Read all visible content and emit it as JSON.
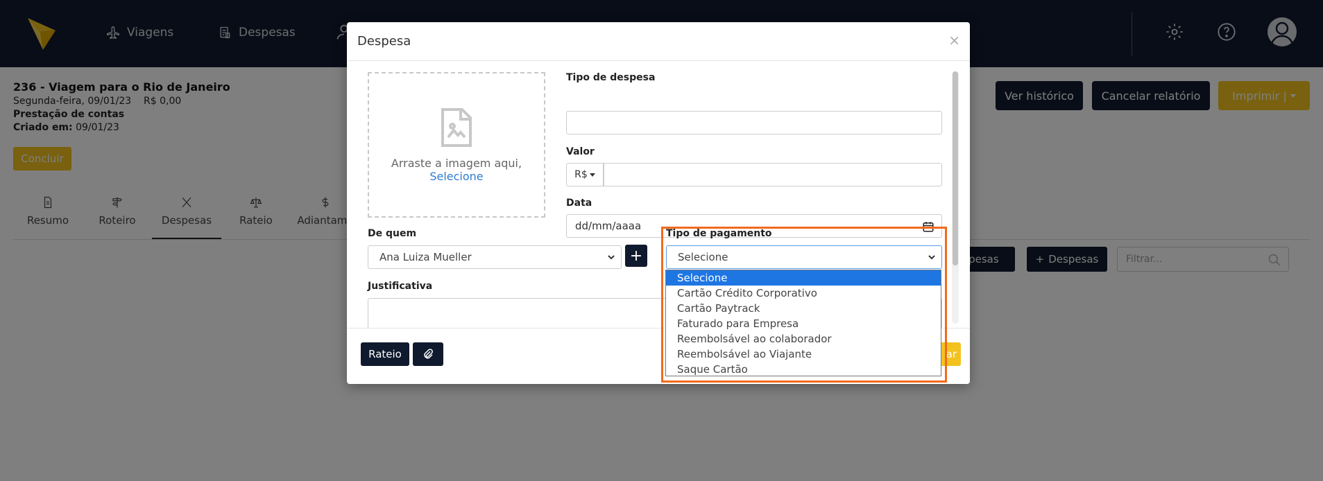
{
  "nav": {
    "items": [
      {
        "label": "Viagens",
        "icon": "airplane-icon"
      },
      {
        "label": "Despesas",
        "icon": "receipt-icon"
      }
    ]
  },
  "report": {
    "title": "236 - Viagem para o Rio de Janeiro",
    "date": "Segunda-feira, 09/01/23",
    "amount": "R$ 0,00",
    "type": "Prestação de contas",
    "created_label": "Criado em:",
    "created_value": "09/01/23",
    "conclude_label": "Concluir"
  },
  "tabs": [
    {
      "label": "Resumo",
      "icon": "document-icon"
    },
    {
      "label": "Roteiro",
      "icon": "signpost-icon"
    },
    {
      "label": "Despesas",
      "icon": "utensils-icon"
    },
    {
      "label": "Rateio",
      "icon": "scale-icon"
    },
    {
      "label": "Adiantame",
      "icon": "dollar-icon"
    }
  ],
  "actions": {
    "history": "Ver histórico",
    "cancel_report": "Cancelar relatório",
    "print": "Imprimir |"
  },
  "list_actions": {
    "expenses_secondary": "spesas",
    "add_expenses": "Despesas",
    "filter_placeholder": "Filtrar..."
  },
  "modal": {
    "title": "Despesa",
    "close": "×",
    "dropzone_text": "Arraste a imagem aqui,",
    "dropzone_link": "Selecione",
    "expense_type_label": "Tipo de despesa",
    "value_label": "Valor",
    "currency": "R$",
    "date_label": "Data",
    "date_placeholder": "dd/mm/aaaa",
    "from_whom_label": "De quem",
    "from_whom_value": "Ana Luiza Mueller",
    "payment_type_label": "Tipo de pagamento",
    "payment_type_value": "Selecione",
    "justification_label": "Justificativa",
    "footer_rateio": "Rateio",
    "footer_partial": "ar"
  },
  "payment_options": [
    "Selecione",
    "Cartão Crédito Corporativo",
    "Cartão Paytrack",
    "Faturado para Empresa",
    "Reembolsável ao colaborador",
    "Reembolsável ao Viajante",
    "Saque Cartão"
  ],
  "colors": {
    "navy": "#101a2e",
    "yellow": "#f3c21f",
    "highlight": "#f26a1b",
    "selected_option": "#1e76e3"
  }
}
